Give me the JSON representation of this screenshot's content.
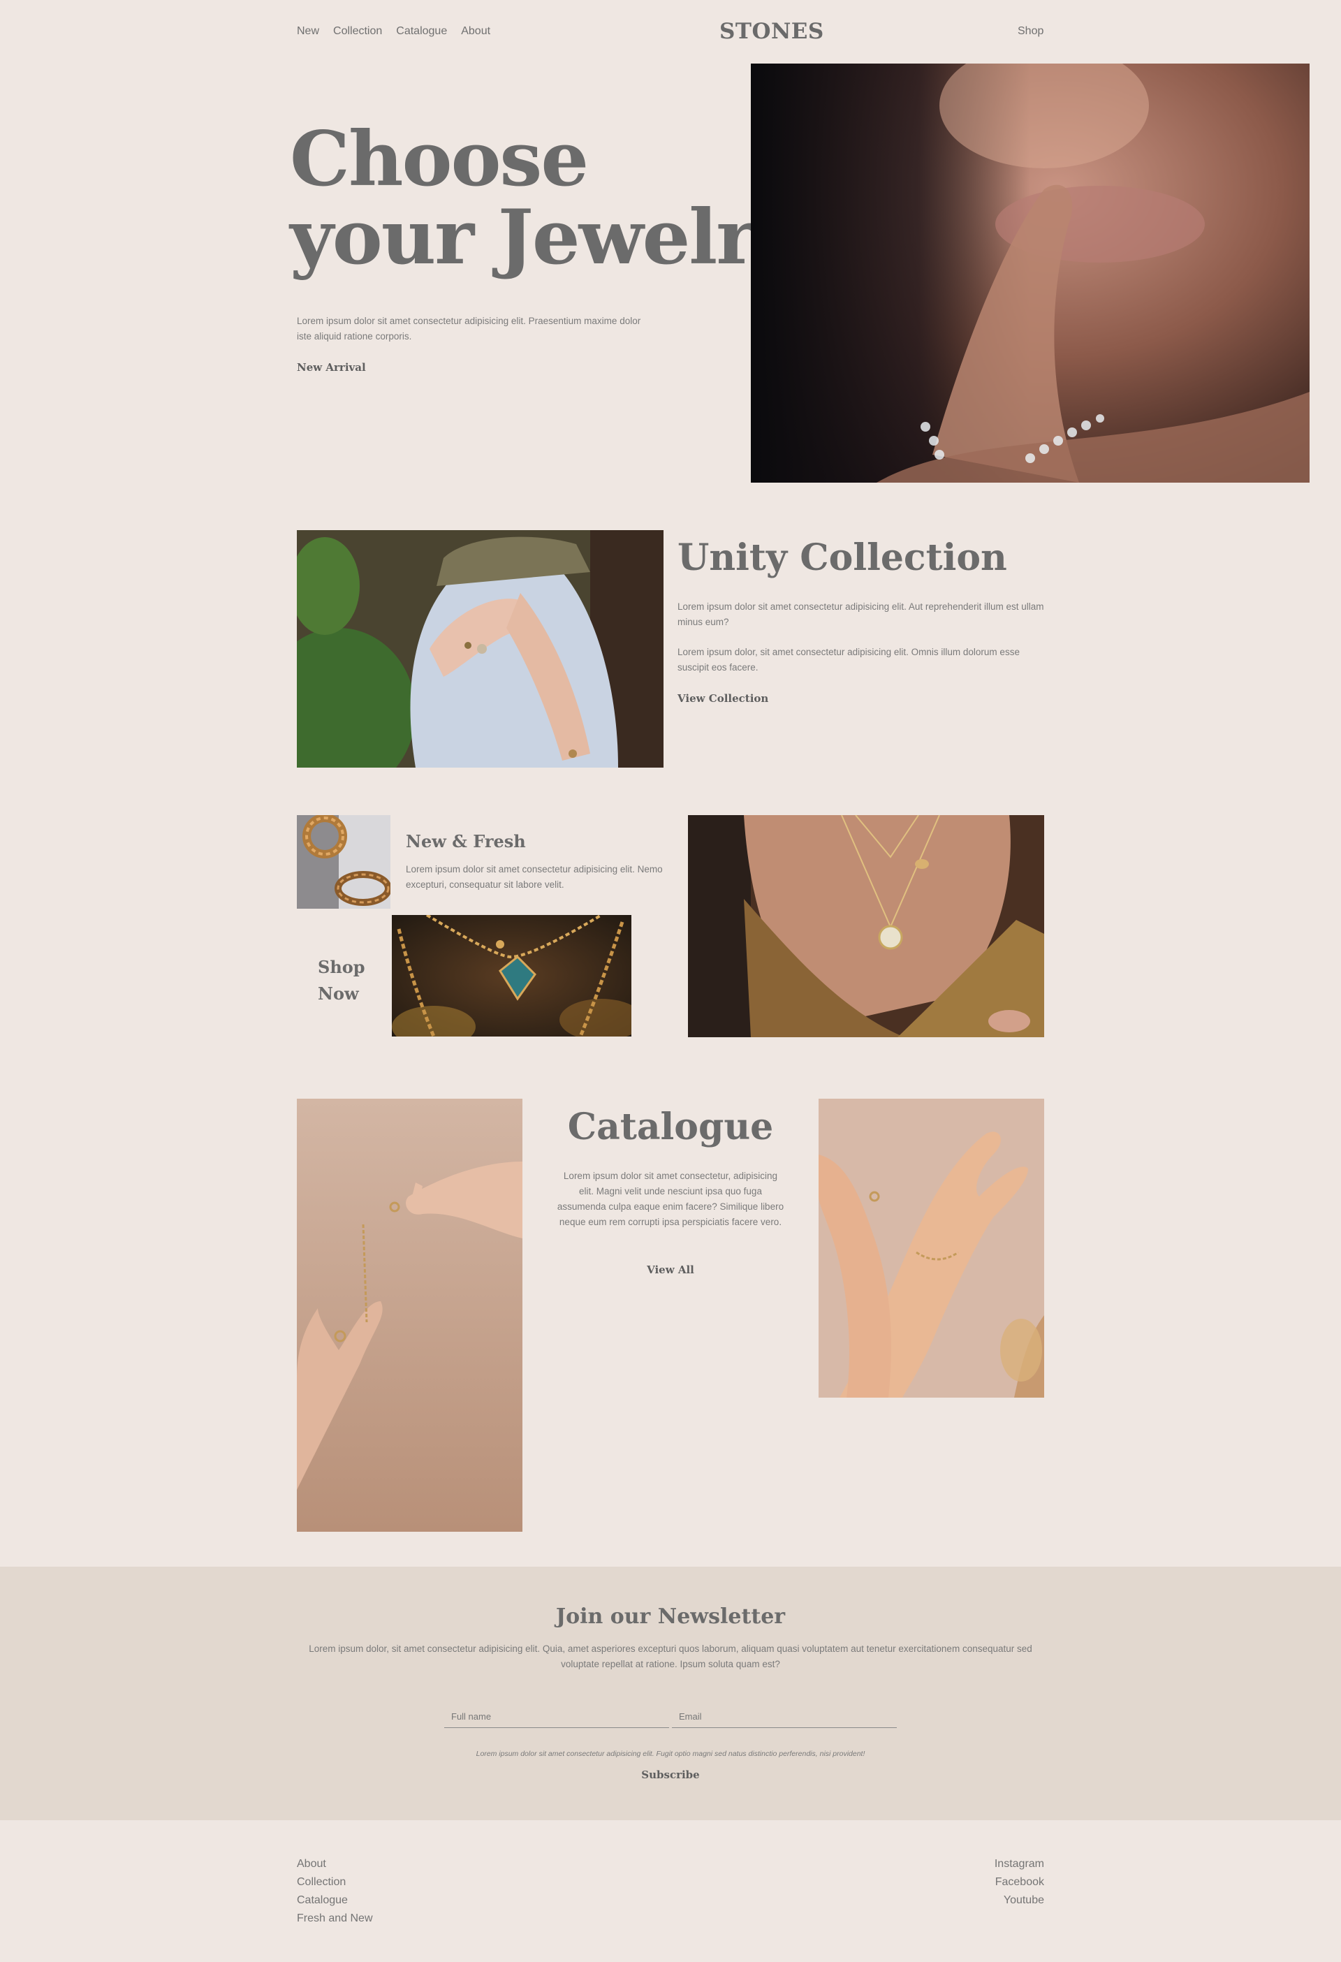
{
  "nav": {
    "items": [
      "New",
      "Collection",
      "Catalogue",
      "About"
    ],
    "logo": "STONES",
    "shop": "Shop"
  },
  "hero": {
    "title_line1": "Choose",
    "title_line2": "your Jewelry",
    "text": "Lorem ipsum dolor sit amet consectetur adipisicing elit. Praesentium maxime dolor iste aliquid ratione corporis.",
    "link": "New Arrival"
  },
  "unity": {
    "title": "Unity Collection",
    "para1": "Lorem ipsum dolor sit amet consectetur adipisicing elit. Aut reprehenderit illum est ullam minus eum?",
    "para2": "Lorem ipsum dolor, sit amet consectetur adipisicing elit. Omnis illum dolorum esse suscipit eos facere.",
    "link": "View Collection"
  },
  "fresh": {
    "title": "New & Fresh",
    "text": "Lorem ipsum dolor sit amet consectetur adipisicing elit. Nemo excepturi, consequatur sit labore velit.",
    "shop_line1": "Shop",
    "shop_line2": "Now"
  },
  "catalogue": {
    "title": "Catalogue",
    "text": "Lorem ipsum dolor sit amet consectetur, adipisicing elit. Magni velit unde nesciunt ipsa quo fuga assumenda culpa eaque enim facere? Similique libero neque eum rem corrupti ipsa perspiciatis facere vero.",
    "link": "View All"
  },
  "newsletter": {
    "title": "Join our Newsletter",
    "text": "Lorem ipsum dolor, sit amet consectetur adipisicing elit. Quia, amet asperiores excepturi quos laborum, aliquam quasi voluptatem aut tenetur exercitationem consequatur sed voluptate repellat at ratione. Ipsum soluta quam est?",
    "name_placeholder": "Full name",
    "email_placeholder": "Email",
    "fine_print": "Lorem ipsum dolor sit amet consectetur adipisicing elit. Fugit optio magni sed natus distinctio perferendis, nisi provident!",
    "button": "Subscribe"
  },
  "footer": {
    "left": [
      "About",
      "Collection",
      "Catalogue",
      "Fresh and New"
    ],
    "right": [
      "Instagram",
      "Facebook",
      "Youtube"
    ]
  },
  "colors": {
    "background": "#efe7e2",
    "newsletter_bg": "#e2d8cf",
    "text": "#6b6b6b"
  }
}
